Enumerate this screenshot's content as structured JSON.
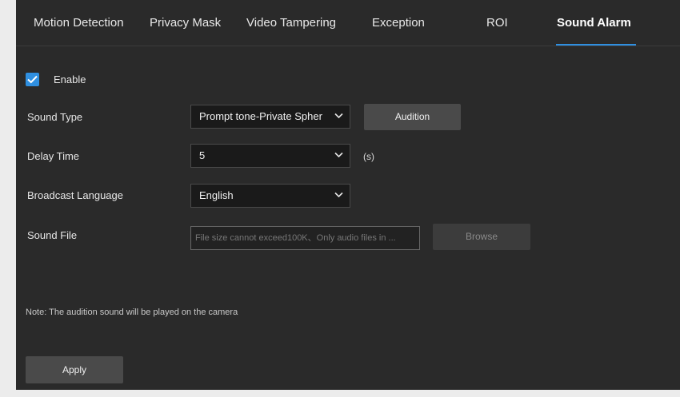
{
  "tabs": [
    {
      "label": "Motion Detection"
    },
    {
      "label": "Privacy Mask"
    },
    {
      "label": "Video Tampering"
    },
    {
      "label": "Exception"
    },
    {
      "label": "ROI"
    },
    {
      "label": "Sound Alarm"
    }
  ],
  "active_tab": "Sound Alarm",
  "form": {
    "enable": {
      "label": "Enable",
      "checked": true
    },
    "sound_type": {
      "label": "Sound Type",
      "value": "Prompt tone-Private Spher"
    },
    "audition_button": "Audition",
    "delay_time": {
      "label": "Delay Time",
      "value": "5",
      "unit": "(s)"
    },
    "broadcast_language": {
      "label": "Broadcast Language",
      "value": "English"
    },
    "sound_file": {
      "label": "Sound File",
      "placeholder": "File size cannot exceed100K、Only audio files in ...",
      "value": ""
    },
    "browse_button": "Browse"
  },
  "note": "Note: The audition sound will be played on the camera",
  "apply_button": "Apply",
  "colors": {
    "accent": "#2f8fe0",
    "panel_bg": "#2a2a2a",
    "button_bg": "#4a4a4a",
    "select_bg": "#1a1a1a"
  },
  "icons": {
    "checkbox": "check-icon",
    "dropdown": "chevron-down-icon"
  }
}
